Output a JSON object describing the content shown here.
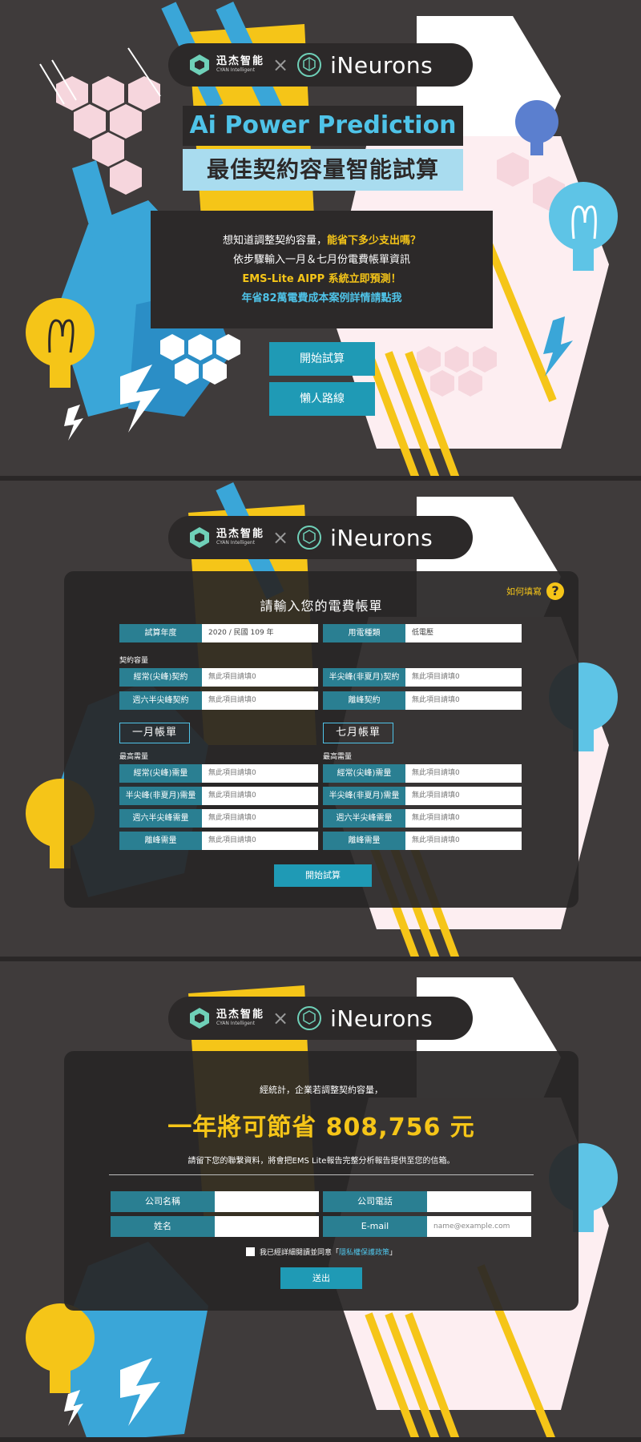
{
  "logo": {
    "brand_a_cn": "迅杰智能",
    "brand_a_en": "CYAN Intelligent",
    "separator": "×",
    "brand_b": "iNeurons"
  },
  "landing": {
    "title_en": "Ai Power Prediction",
    "title_cn": "最佳契約容量智能試算",
    "intro_line1_a": "想知道調整契約容量，",
    "intro_line1_b": "能省下多少支出嗎？",
    "intro_line2": "依步驟輸入一月＆七月份電費帳單資訊",
    "intro_line3": "EMS-Lite AIPP 系統立即預測！",
    "intro_line4": "年省82萬電費成本案例詳情請點我",
    "start_button": "開始試算",
    "lazy_button": "懶人路線"
  },
  "bill_form": {
    "howto_label": "如何填寫",
    "howto_icon": "?",
    "title": "請輸入您的電費帳單",
    "year_label": "試算年度",
    "year_value": "2020 / 民國 109 年",
    "type_label": "用電種類",
    "type_value": "低電壓",
    "contract_section": "契約容量",
    "contract_fields": [
      {
        "label": "經常(尖峰)契約",
        "placeholder": "無此項目請填0"
      },
      {
        "label": "半尖峰(非夏月)契約",
        "placeholder": "無此項目請填0"
      },
      {
        "label": "週六半尖峰契約",
        "placeholder": "無此項目請填0"
      },
      {
        "label": "離峰契約",
        "placeholder": "無此項目請填0"
      }
    ],
    "jan_tab": "一月帳單",
    "jul_tab": "七月帳單",
    "demand_section": "最高需量",
    "jan_fields": [
      {
        "label": "經常(尖峰)需量",
        "placeholder": "無此項目請填0"
      },
      {
        "label": "半尖峰(非夏月)需量",
        "placeholder": "無此項目請填0"
      },
      {
        "label": "週六半尖峰需量",
        "placeholder": "無此項目請填0"
      },
      {
        "label": "離峰需量",
        "placeholder": "無此項目請填0"
      }
    ],
    "jul_fields": [
      {
        "label": "經常(尖峰)需量",
        "placeholder": "無此項目請填0"
      },
      {
        "label": "半尖峰(非夏月)需量",
        "placeholder": "無此項目請填0"
      },
      {
        "label": "週六半尖峰需量",
        "placeholder": "無此項目請填0"
      },
      {
        "label": "離峰需量",
        "placeholder": "無此項目請填0"
      }
    ],
    "submit_button": "開始試算"
  },
  "result": {
    "line1": "經統計，企業若調整契約容量，",
    "line2": "一年將可節省 808,756 元",
    "line3": "請留下您的聯繫資料，將會把EMS Lite報告完整分析報告提供至您的信箱。",
    "company_label": "公司名稱",
    "phone_label": "公司電話",
    "name_label": "姓名",
    "email_label": "E-mail",
    "email_placeholder": "name@example.com",
    "agree_text": "我已經詳細閱讀並同意「",
    "agree_link": "隱私權保護政策",
    "agree_end": "」",
    "send_button": "送出"
  },
  "colors": {
    "background": "#3f3b3b",
    "accent_blue": "#4fc3e8",
    "accent_yellow": "#f5c518",
    "teal_label": "#2a7f92",
    "button_teal": "#1f9ab5"
  }
}
